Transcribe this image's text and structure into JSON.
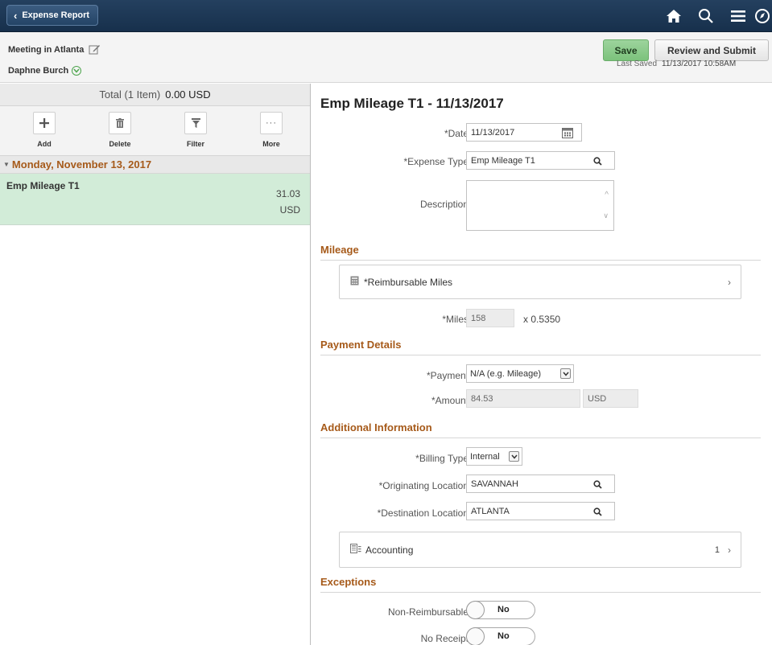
{
  "topbar": {
    "back_label": "Expense Report",
    "icons": [
      "home-icon",
      "search-icon",
      "menu-icon",
      "navbar-icon"
    ]
  },
  "header": {
    "report_name": "Meeting in Atlanta",
    "employee": "Daphne Burch",
    "save_label": "Save",
    "submit_label": "Review and Submit",
    "last_saved_label": "Last Saved",
    "last_saved_value": "11/13/2017 10:58AM"
  },
  "left": {
    "total_label": "Total (1 Item)",
    "total_amount": "0.00  USD",
    "toolbar": [
      {
        "label": "Add",
        "icon": "plus-icon"
      },
      {
        "label": "Delete",
        "icon": "trash-icon"
      },
      {
        "label": "Filter",
        "icon": "filter-icon"
      },
      {
        "label": "More",
        "icon": "more-icon"
      }
    ],
    "day_header": "Monday, November 13, 2017",
    "item": {
      "name": "Emp Mileage T1",
      "amount": "31.03",
      "currency": "USD"
    }
  },
  "detail": {
    "title": "Emp Mileage T1 - 11/13/2017",
    "date_label": "*Date",
    "date_value": "11/13/2017",
    "expense_type_label": "*Expense Type",
    "expense_type_value": "Emp Mileage T1",
    "description_label": "Description",
    "description_value": "",
    "mileage_section": "Mileage",
    "reimbursable_miles_label": "*Reimbursable Miles",
    "miles_label": "*Miles",
    "miles_value": "158",
    "rate_text": "x  0.5350",
    "payment_section": "Payment Details",
    "payment_label": "*Payment",
    "payment_value": "N/A (e.g. Mileage)",
    "amount_label": "*Amount",
    "amount_value": "84.53",
    "amount_currency": "USD",
    "additional_section": "Additional Information",
    "billing_type_label": "*Billing Type",
    "billing_type_value": "Internal",
    "orig_location_label": "*Originating Location",
    "orig_location_value": "SAVANNAH",
    "dest_location_label": "*Destination Location",
    "dest_location_value": "ATLANTA",
    "accounting_label": "Accounting",
    "accounting_count": "1",
    "exceptions_section": "Exceptions",
    "non_reimbursable_label": "Non-Reimbursable",
    "non_reimbursable_value": "No",
    "no_receipt_label": "No Receipt",
    "no_receipt_value": "No"
  }
}
